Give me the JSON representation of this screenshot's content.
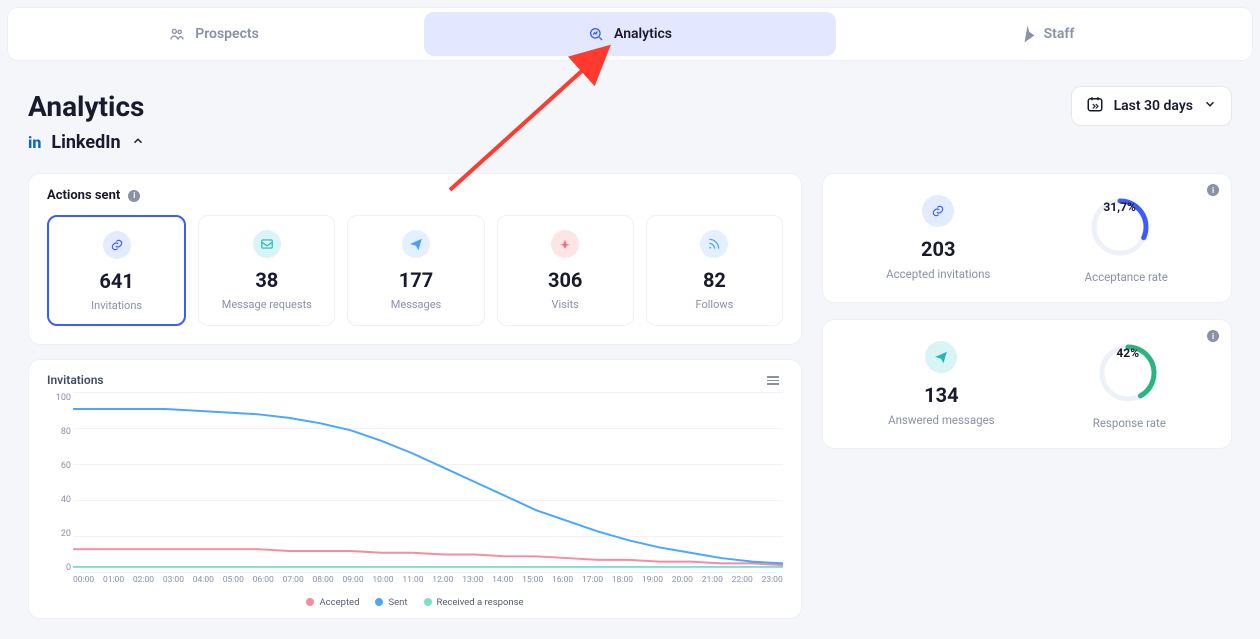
{
  "nav": {
    "tabs": [
      {
        "label": "Prospects",
        "icon": "prospects"
      },
      {
        "label": "Analytics",
        "icon": "analytics"
      },
      {
        "label": "Staff",
        "icon": "staff"
      }
    ],
    "active_index": 1
  },
  "page": {
    "title": "Analytics",
    "date_range_label": "Last 30 days"
  },
  "section": {
    "platform": "LinkedIn",
    "platform_short": "in",
    "actions_title": "Actions sent",
    "stats": [
      {
        "value": "641",
        "label": "Invitations",
        "icon": "link",
        "color": "blue",
        "selected": true
      },
      {
        "value": "38",
        "label": "Message requests",
        "icon": "inbox",
        "color": "teal"
      },
      {
        "value": "177",
        "label": "Messages",
        "icon": "plane",
        "color": "sky"
      },
      {
        "value": "306",
        "label": "Visits",
        "icon": "nav",
        "color": "pink"
      },
      {
        "value": "82",
        "label": "Follows",
        "icon": "rss",
        "color": "cyan"
      }
    ]
  },
  "chart_data": {
    "type": "line",
    "title": "Invitations",
    "xlabel": "",
    "ylabel": "",
    "ylim": [
      0,
      100
    ],
    "yticks": [
      0,
      20,
      40,
      60,
      80,
      100
    ],
    "categories": [
      "00:00",
      "01:00",
      "02:00",
      "03:00",
      "04:00",
      "05:00",
      "06:00",
      "07:00",
      "08:00",
      "09:00",
      "10:00",
      "11:00",
      "12:00",
      "13:00",
      "14:00",
      "15:00",
      "16:00",
      "17:00",
      "18:00",
      "19:00",
      "20:00",
      "21:00",
      "22:00",
      "23:00"
    ],
    "series": [
      {
        "name": "Accepted",
        "color": "#f58ca0",
        "values": [
          12,
          12,
          12,
          12,
          12,
          12,
          12,
          11,
          11,
          11,
          10,
          10,
          9,
          9,
          8,
          8,
          7,
          6,
          6,
          5,
          5,
          4,
          4,
          3
        ]
      },
      {
        "name": "Sent",
        "color": "#4aa7ff",
        "values": [
          91,
          91,
          91,
          91,
          90,
          89,
          88,
          86,
          83,
          79,
          73,
          66,
          58,
          50,
          42,
          34,
          28,
          22,
          17,
          13,
          10,
          7,
          5,
          4
        ]
      },
      {
        "name": "Received a response",
        "color": "#7ee0c8",
        "values": [
          2,
          2,
          2,
          2,
          2,
          2,
          2,
          2,
          2,
          2,
          2,
          2,
          2,
          2,
          2,
          2,
          2,
          2,
          2,
          2,
          2,
          2,
          2,
          2
        ]
      }
    ]
  },
  "kpis": [
    {
      "icon": "link",
      "icon_color": "blue",
      "value": "203",
      "value_label": "Accepted invitations",
      "ring_pct": 31.7,
      "ring_pct_label": "31,7%",
      "ring_color": "#3b5bff",
      "ring_label": "Acceptance rate"
    },
    {
      "icon": "plane",
      "icon_color": "teal",
      "value": "134",
      "value_label": "Answered messages",
      "ring_pct": 42,
      "ring_pct_label": "42%",
      "ring_color": "#2bb57e",
      "ring_label": "Response rate"
    }
  ]
}
